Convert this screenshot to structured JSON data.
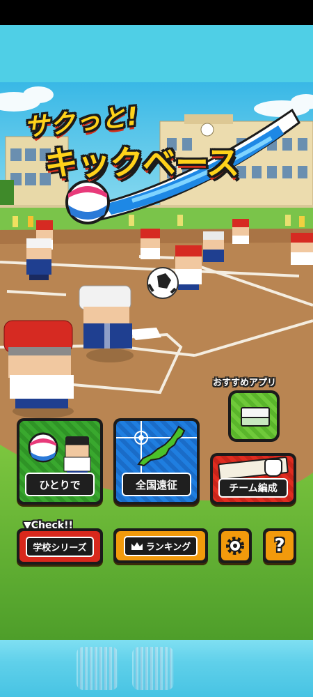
{
  "title": {
    "line1": "サクっと!",
    "line2": "キックベース"
  },
  "menu": {
    "single": {
      "label": "ひとりで"
    },
    "national": {
      "label": "全国遠征"
    },
    "team": {
      "label": "チーム編成"
    },
    "recommend": {
      "label": "おすすめアプリ"
    },
    "check_tag": "▼Check!!",
    "school": {
      "label": "学校シリーズ"
    },
    "ranking": {
      "label": "ランキング"
    }
  },
  "colors": {
    "sky": "#4fcfe6",
    "dirt": "#b07a4a",
    "grass": "#6ab83a",
    "green_btn": "#2e9c2a",
    "blue_btn": "#1a6fd6",
    "red_btn": "#d8281c",
    "orange_btn": "#f29a0c",
    "title_yellow": "#ffd21a",
    "title_red": "#e8331c"
  },
  "icons": [
    "ball-icon",
    "player-icon",
    "japan-map-icon",
    "crosshair-icon",
    "note-card-icon",
    "hand-pointer-icon",
    "crown-icon",
    "gear-icon",
    "question-icon",
    "app-icon"
  ]
}
